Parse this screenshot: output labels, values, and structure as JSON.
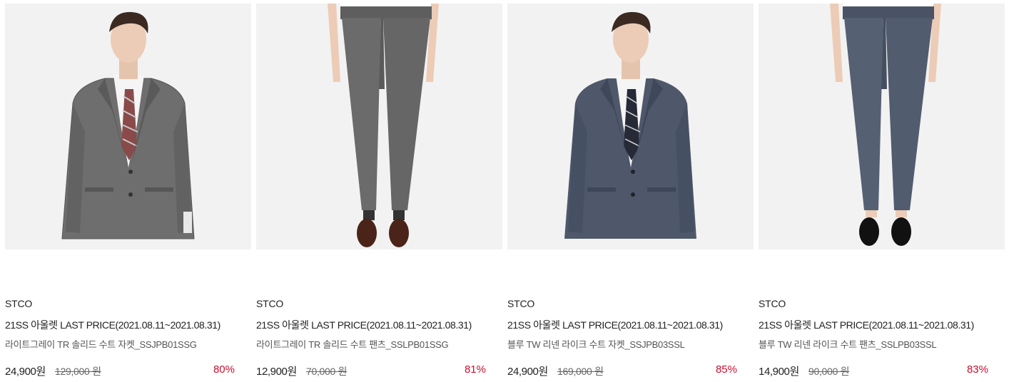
{
  "products": [
    {
      "brand": "STCO",
      "event": "21SS 아울렛 LAST PRICE(2021.08.11~2021.08.31)",
      "name": "라이트그레이 TR 솔리드 수트 자켓_SSJPB01SSG",
      "price": "24,900원",
      "original_price": "129,000 원",
      "discount": "80%",
      "image": "gray-suit-jacket-model"
    },
    {
      "brand": "STCO",
      "event": "21SS 아울렛 LAST PRICE(2021.08.11~2021.08.31)",
      "name": "라이트그레이 TR 솔리드 수트 팬츠_SSLPB01SSG",
      "price": "12,900원",
      "original_price": "70,000 원",
      "discount": "81%",
      "image": "gray-suit-pants"
    },
    {
      "brand": "STCO",
      "event": "21SS 아울렛 LAST PRICE(2021.08.11~2021.08.31)",
      "name": "블루 TW 리넨 라이크 수트 자켓_SSJPB03SSL",
      "price": "24,900원",
      "original_price": "169,000 원",
      "discount": "85%",
      "image": "blue-suit-jacket-model"
    },
    {
      "brand": "STCO",
      "event": "21SS 아울렛 LAST PRICE(2021.08.11~2021.08.31)",
      "name": "블루 TW 리넨 라이크 수트 팬츠_SSLPB03SSL",
      "price": "14,900원",
      "original_price": "90,000 원",
      "discount": "83%",
      "image": "blue-suit-pants"
    }
  ],
  "colors": {
    "discount": "#c8102e",
    "gray_suit": "#6b6b6b",
    "blue_suit": "#4b5566",
    "photo_bg": "#f2f2f2"
  }
}
